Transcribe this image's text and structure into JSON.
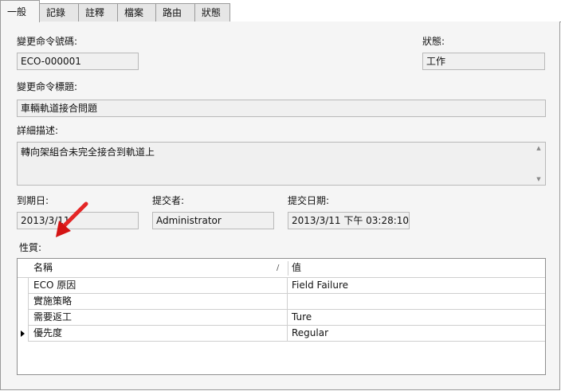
{
  "tabs": [
    {
      "label": "一般",
      "active": true
    },
    {
      "label": "記錄"
    },
    {
      "label": "註釋"
    },
    {
      "label": "檔案"
    },
    {
      "label": "路由"
    },
    {
      "label": "狀態"
    }
  ],
  "form": {
    "eco_number": {
      "label": "變更命令號碼:",
      "value": "ECO-000001"
    },
    "status": {
      "label": "狀態:",
      "value": "工作"
    },
    "eco_title": {
      "label": "變更命令標題:",
      "value": "車輛軌道接合問題"
    },
    "description": {
      "label": "詳細描述:",
      "value": "轉向架組合未完全接合到軌道上"
    },
    "due_date": {
      "label": "到期日:",
      "value": "2013/3/11"
    },
    "submitter": {
      "label": "提交者:",
      "value": "Administrator"
    },
    "submit_date": {
      "label": "提交日期:",
      "value": "2013/3/11 下午 03:28:10"
    },
    "properties_label": "性質:"
  },
  "properties_grid": {
    "columns": [
      "名稱",
      "值"
    ],
    "sort_indicator": "/",
    "rows": [
      {
        "name": "ECO 原因",
        "value": "Field Failure"
      },
      {
        "name": "實施策略",
        "value": ""
      },
      {
        "name": "需要返工",
        "value": "Ture"
      },
      {
        "name": "優先度",
        "value": "Regular",
        "current": true
      }
    ]
  },
  "colors": {
    "annotation_arrow": "#e02020"
  }
}
